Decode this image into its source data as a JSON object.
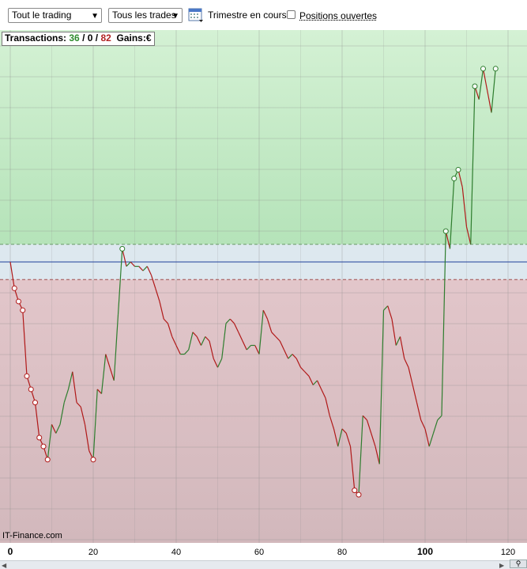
{
  "toolbar": {
    "scope_select": "Tout le trading",
    "trades_select": "Tous les trades",
    "period_label": "Trimestre en cours",
    "open_positions_label": "Positions ouvertes",
    "open_positions_checked": false
  },
  "stats": {
    "transactions_label": "Transactions:",
    "won": "36",
    "sep1": " / ",
    "neutral": "0",
    "sep2": " / ",
    "lost": "82",
    "gains_label": "Gains:",
    "gains_unit": "€"
  },
  "watermark": "IT-Finance.com",
  "colors": {
    "profit_zone": "#c8ecc8",
    "loss_zone": "#dcbcc0",
    "neutral_band": "#dde8ef",
    "up_segment": "#2e7d2e",
    "down_segment": "#b01818",
    "baseline": "#1f3f9a"
  },
  "chart_data": {
    "type": "line",
    "xlabel": "",
    "ylabel": "",
    "xlim": [
      -2,
      123
    ],
    "ylim": [
      -99,
      24
    ],
    "x_ticks": [
      "0",
      "20",
      "40",
      "60",
      "80",
      "100",
      "120"
    ],
    "x_tick_values": [
      0,
      20,
      40,
      60,
      80,
      100,
      120
    ],
    "baseline": 0,
    "neutral_band": [
      -4,
      4
    ],
    "grid": true,
    "y_units": "relative (no axis labels printed)",
    "series": [
      {
        "values": [
          [
            0,
            0
          ],
          [
            1,
            -6
          ],
          [
            2,
            -9
          ],
          [
            3,
            -11
          ],
          [
            4,
            -26
          ],
          [
            5,
            -29
          ],
          [
            6,
            -32
          ],
          [
            7,
            -40
          ],
          [
            8,
            -42
          ],
          [
            9,
            -45
          ],
          [
            10,
            -37
          ],
          [
            11,
            -39
          ],
          [
            12,
            -37
          ],
          [
            13,
            -32
          ],
          [
            14,
            -29
          ],
          [
            15,
            -25
          ],
          [
            16,
            -32
          ],
          [
            17,
            -33
          ],
          [
            18,
            -37
          ],
          [
            19,
            -43
          ],
          [
            20,
            -45
          ],
          [
            21,
            -29
          ],
          [
            22,
            -30
          ],
          [
            23,
            -21
          ],
          [
            24,
            -24
          ],
          [
            25,
            -27
          ],
          [
            26,
            -12
          ],
          [
            27,
            3
          ],
          [
            28,
            -1
          ],
          [
            29,
            0
          ],
          [
            30,
            -1
          ],
          [
            31,
            -1
          ],
          [
            32,
            -2
          ],
          [
            33,
            -1
          ],
          [
            34,
            -3
          ],
          [
            35,
            -6
          ],
          [
            36,
            -9
          ],
          [
            37,
            -13
          ],
          [
            38,
            -14
          ],
          [
            39,
            -17
          ],
          [
            40,
            -19
          ],
          [
            41,
            -21
          ],
          [
            42,
            -21
          ],
          [
            43,
            -20
          ],
          [
            44,
            -16
          ],
          [
            45,
            -17
          ],
          [
            46,
            -19
          ],
          [
            47,
            -17
          ],
          [
            48,
            -18
          ],
          [
            49,
            -22
          ],
          [
            50,
            -24
          ],
          [
            51,
            -22
          ],
          [
            52,
            -14
          ],
          [
            53,
            -13
          ],
          [
            54,
            -14
          ],
          [
            55,
            -16
          ],
          [
            56,
            -18
          ],
          [
            57,
            -20
          ],
          [
            58,
            -19
          ],
          [
            59,
            -19
          ],
          [
            60,
            -21
          ],
          [
            61,
            -11
          ],
          [
            62,
            -13
          ],
          [
            63,
            -16
          ],
          [
            64,
            -17
          ],
          [
            65,
            -18
          ],
          [
            66,
            -20
          ],
          [
            67,
            -22
          ],
          [
            68,
            -21
          ],
          [
            69,
            -22
          ],
          [
            70,
            -24
          ],
          [
            71,
            -25
          ],
          [
            72,
            -26
          ],
          [
            73,
            -28
          ],
          [
            74,
            -27
          ],
          [
            75,
            -29
          ],
          [
            76,
            -31
          ],
          [
            77,
            -35
          ],
          [
            78,
            -38
          ],
          [
            79,
            -42
          ],
          [
            80,
            -38
          ],
          [
            81,
            -39
          ],
          [
            82,
            -42
          ],
          [
            83,
            -52
          ],
          [
            84,
            -53
          ],
          [
            85,
            -35
          ],
          [
            86,
            -36
          ],
          [
            87,
            -39
          ],
          [
            88,
            -42
          ],
          [
            89,
            -46
          ],
          [
            90,
            -11
          ],
          [
            91,
            -10
          ],
          [
            92,
            -13
          ],
          [
            93,
            -19
          ],
          [
            94,
            -17
          ],
          [
            95,
            -22
          ],
          [
            96,
            -24
          ],
          [
            97,
            -28
          ],
          [
            98,
            -32
          ],
          [
            99,
            -36
          ],
          [
            100,
            -38
          ],
          [
            101,
            -42
          ],
          [
            102,
            -39
          ],
          [
            103,
            -36
          ],
          [
            104,
            -35
          ],
          [
            105,
            7
          ],
          [
            106,
            3
          ],
          [
            107,
            19
          ],
          [
            108,
            21
          ],
          [
            109,
            17
          ],
          [
            110,
            8
          ],
          [
            111,
            4
          ],
          [
            112,
            40
          ],
          [
            113,
            37
          ],
          [
            114,
            44
          ],
          [
            115,
            39
          ],
          [
            116,
            34
          ],
          [
            117,
            44
          ]
        ]
      }
    ],
    "markers": [
      [
        1,
        -6
      ],
      [
        2,
        -9
      ],
      [
        3,
        -11
      ],
      [
        4,
        -26
      ],
      [
        5,
        -29
      ],
      [
        6,
        -32
      ],
      [
        7,
        -40
      ],
      [
        8,
        -42
      ],
      [
        9,
        -45
      ],
      [
        20,
        -45
      ],
      [
        27,
        3
      ],
      [
        83,
        -52
      ],
      [
        84,
        -53
      ],
      [
        105,
        7
      ],
      [
        107,
        19
      ],
      [
        108,
        21
      ],
      [
        112,
        40
      ],
      [
        114,
        44
      ],
      [
        117,
        44
      ]
    ]
  }
}
